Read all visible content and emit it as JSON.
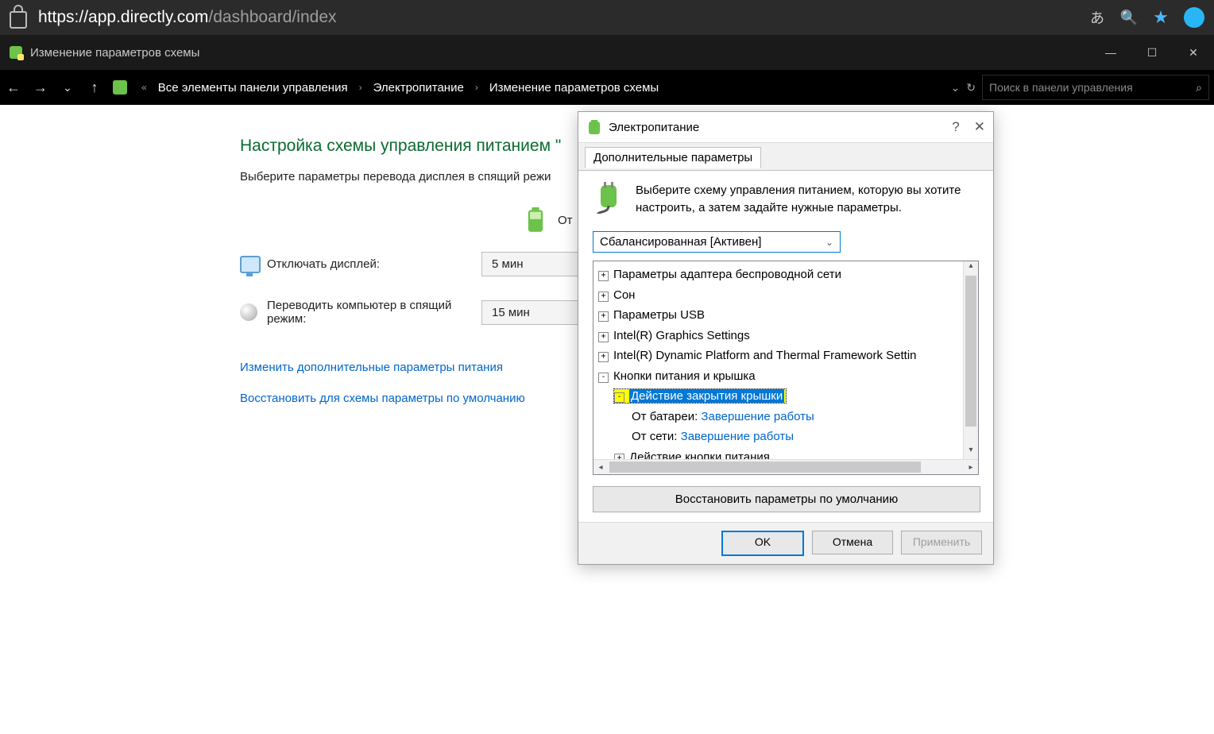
{
  "browser": {
    "url_host": "https://app.directly.com",
    "url_path": "/dashboard/index"
  },
  "cp_window": {
    "title": "Изменение параметров схемы",
    "breadcrumb": {
      "root": "Все элементы панели управления",
      "level2": "Электропитание",
      "level3": "Изменение параметров схемы"
    },
    "search_placeholder": "Поиск в панели управления"
  },
  "page": {
    "heading": "Настройка схемы управления питанием \"",
    "subheading": "Выберите параметры перевода дисплея в спящий режи",
    "from_label": "От",
    "rows": {
      "display_off": {
        "label": "Отключать дисплей:",
        "value": "5 мин"
      },
      "sleep": {
        "label": "Переводить компьютер в спящий режим:",
        "value": "15 мин"
      }
    },
    "link_advanced": "Изменить дополнительные параметры питания",
    "link_restore": "Восстановить для схемы параметры по умолчанию"
  },
  "dialog": {
    "title": "Электропитание",
    "tab": "Дополнительные параметры",
    "description": "Выберите схему управления питанием, которую вы хотите настроить, а затем задайте нужные параметры.",
    "plan": "Сбалансированная [Активен]",
    "tree": {
      "n0": "Параметры адаптера беспроводной сети",
      "n1": "Сон",
      "n2": "Параметры USB",
      "n3": "Intel(R) Graphics Settings",
      "n4": "Intel(R) Dynamic Platform and Thermal Framework Settin",
      "n5": "Кнопки питания и крышка",
      "n5a": "Действие закрытия крышки",
      "n5a_bat_label": "От батареи: ",
      "n5a_bat_value": "Завершение работы",
      "n5a_ac_label": "От сети: ",
      "n5a_ac_value": "Завершение работы",
      "n5b": "Действие кнопки питания"
    },
    "restore": "Восстановить параметры по умолчанию",
    "buttons": {
      "ok": "OK",
      "cancel": "Отмена",
      "apply": "Применить"
    }
  }
}
